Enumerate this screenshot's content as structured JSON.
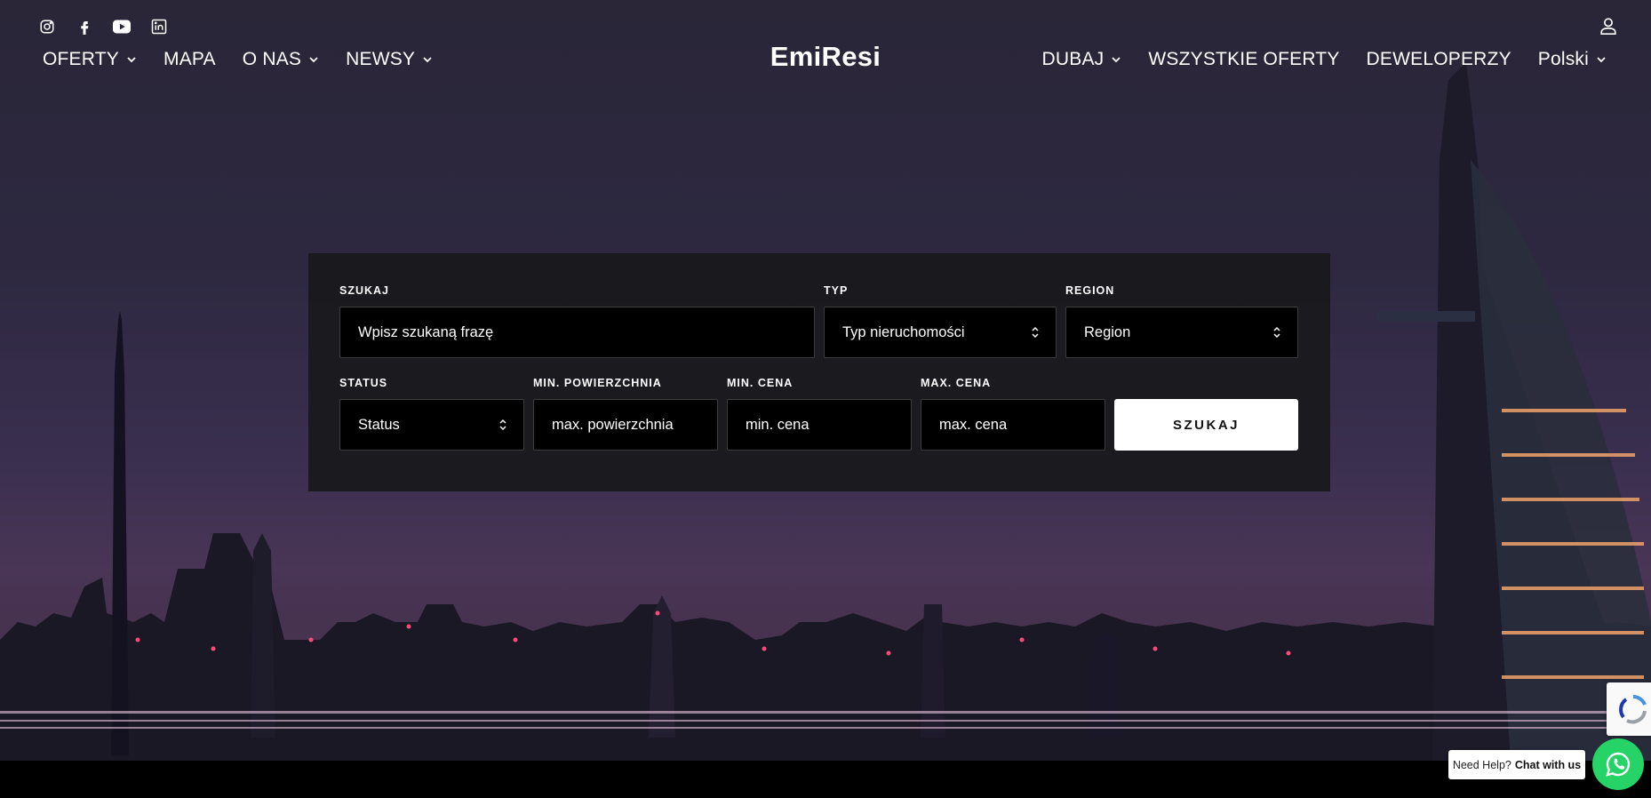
{
  "header": {
    "logo": "EmiResi",
    "social": [
      "instagram-icon",
      "facebook-icon",
      "youtube-icon",
      "linkedin-icon"
    ],
    "nav_left": [
      {
        "label": "OFERTY",
        "dropdown": true
      },
      {
        "label": "MAPA",
        "dropdown": false
      },
      {
        "label": "O NAS",
        "dropdown": true
      },
      {
        "label": "NEWSY",
        "dropdown": true
      }
    ],
    "nav_right": [
      {
        "label": "DUBAJ",
        "dropdown": true
      },
      {
        "label": "WSZYSTKIE OFERTY",
        "dropdown": false
      },
      {
        "label": "DEWELOPERZY",
        "dropdown": false
      },
      {
        "label": "Polski",
        "dropdown": true
      }
    ]
  },
  "search": {
    "query_label": "SZUKAJ",
    "query_placeholder": "Wpisz szukaną frazę",
    "type_label": "TYP",
    "type_value": "Typ nieruchomości",
    "region_label": "REGION",
    "region_value": "Region",
    "status_label": "STATUS",
    "status_value": "Status",
    "area_label": "MIN. POWIERZCHNIA",
    "area_placeholder": "max. powierzchnia",
    "min_price_label": "MIN. CENA",
    "min_price_placeholder": "min. cena",
    "max_price_label": "MAX. CENA",
    "max_price_placeholder": "max. cena",
    "submit_label": "SZUKAJ"
  },
  "chat": {
    "prefix": "Need Help?",
    "cta": "Chat with us"
  },
  "colors": {
    "whatsapp": "#25d366",
    "panel": "#1a1a1c"
  }
}
